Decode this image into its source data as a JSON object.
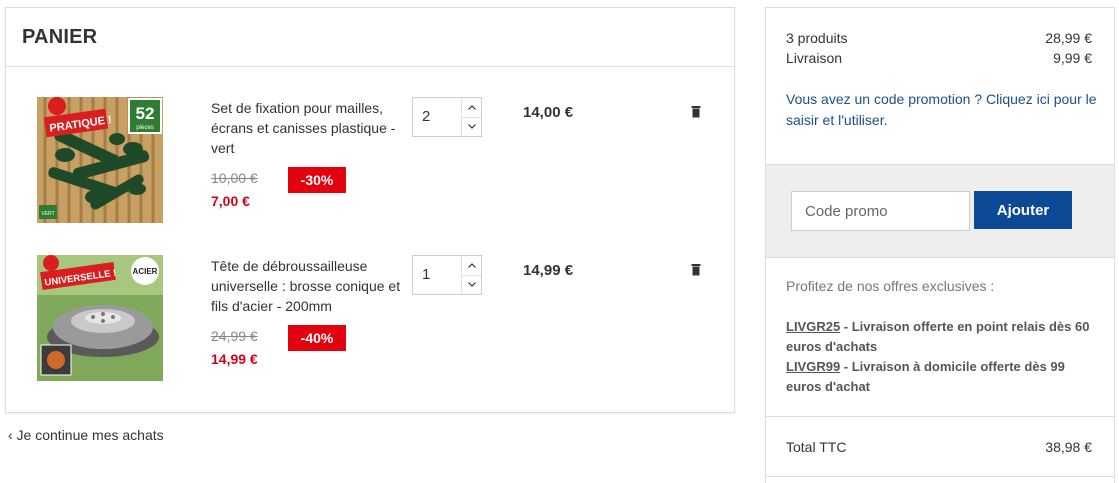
{
  "cart": {
    "title": "PANIER",
    "items": [
      {
        "name": "Set de fixation pour mailles, écrans et canisses plastique - vert",
        "old_price": "10,00 €",
        "new_price": "7,00 €",
        "discount": "-30%",
        "quantity": "2",
        "line_total": "14,00 €",
        "image_badge_text": "PRATIQUE !",
        "image_count_text": "52",
        "image_count_unit": "pièces",
        "image_corner_text": "VERT"
      },
      {
        "name": "Tête de débroussailleuse universelle : brosse conique et fils d'acier - 200mm",
        "old_price": "24,99 €",
        "new_price": "14,99 €",
        "discount": "-40%",
        "quantity": "1",
        "line_total": "14,99 €",
        "image_badge_text": "UNIVERSELLE !",
        "image_corner_text": "ACIER"
      }
    ],
    "continue_label": "‹ Je continue mes achats",
    "icons": {
      "increment": "chevron-up-icon",
      "decrement": "chevron-down-icon",
      "remove": "trash-icon"
    }
  },
  "summary": {
    "products_label": "3 produits",
    "products_value": "28,99 €",
    "shipping_label": "Livraison",
    "shipping_value": "9,99 €",
    "promo_prompt": "Vous avez un code promotion ? Cliquez ici pour le saisir et l'utiliser.",
    "promo_placeholder": "Code promo",
    "promo_button": "Ajouter",
    "offers_title": "Profitez de nos offres exclusives :",
    "offers": [
      {
        "code": "LIVGR25",
        "text": " - Livraison offerte en point relais dès 60 euros d'achats"
      },
      {
        "code": "LIVGR99",
        "text": " - Livraison à domicile offerte dès 99 euros d'achat"
      }
    ],
    "total_label": "Total TTC",
    "total_value": "38,98 €"
  },
  "colors": {
    "accent_blue": "#0d4a96",
    "link_blue": "#1b4f8c",
    "sale_red": "#e3000f",
    "price_red": "#d0021b"
  }
}
